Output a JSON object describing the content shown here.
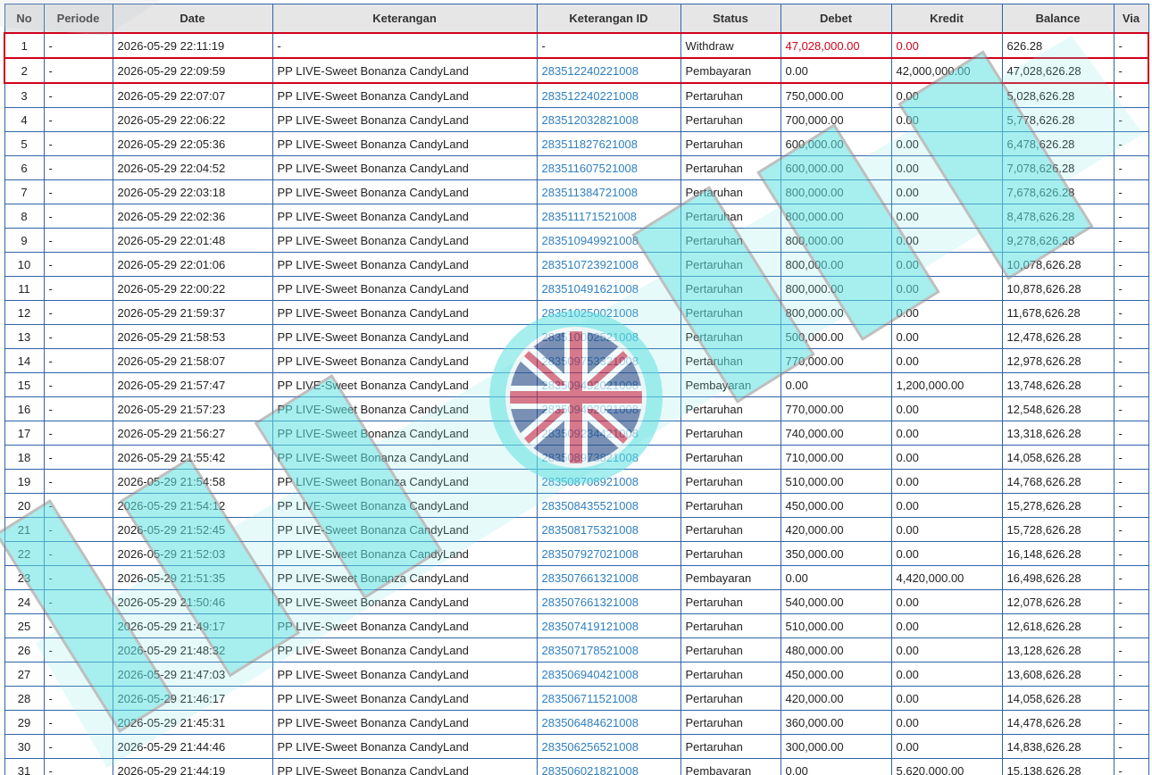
{
  "colors": {
    "accent_border": "#2f63a8",
    "highlight_border": "#d0021b",
    "link": "#2f7fc0",
    "header_bg": "#e6e6e6",
    "watermark": "#5fe0e0"
  },
  "watermark_icon": "union-jack-icon",
  "table": {
    "headers": [
      "No",
      "Periode",
      "Date",
      "Keterangan",
      "Keterangan ID",
      "Status",
      "Debet",
      "Kredit",
      "Balance",
      "Via"
    ],
    "rows": [
      {
        "no": "1",
        "periode": "-",
        "date": "2026-05-29 22:11:19",
        "keterangan": "-",
        "id": "-",
        "status": "Withdraw",
        "debet": "47,028,000.00",
        "kredit": "0.00",
        "balance": "626.28",
        "via": "-",
        "highlight": true,
        "red": true
      },
      {
        "no": "2",
        "periode": "-",
        "date": "2026-05-29 22:09:59",
        "keterangan": "PP LIVE-Sweet Bonanza CandyLand",
        "id": "283512240221008",
        "status": "Pembayaran",
        "debet": "0.00",
        "kredit": "42,000,000.00",
        "balance": "47,028,626.28",
        "via": "-",
        "highlight": true
      },
      {
        "no": "3",
        "periode": "-",
        "date": "2026-05-29 22:07:07",
        "keterangan": "PP LIVE-Sweet Bonanza CandyLand",
        "id": "283512240221008",
        "status": "Pertaruhan",
        "debet": "750,000.00",
        "kredit": "0.00",
        "balance": "5,028,626.28",
        "via": "-"
      },
      {
        "no": "4",
        "periode": "-",
        "date": "2026-05-29 22:06:22",
        "keterangan": "PP LIVE-Sweet Bonanza CandyLand",
        "id": "283512032821008",
        "status": "Pertaruhan",
        "debet": "700,000.00",
        "kredit": "0.00",
        "balance": "5,778,626.28",
        "via": "-"
      },
      {
        "no": "5",
        "periode": "-",
        "date": "2026-05-29 22:05:36",
        "keterangan": "PP LIVE-Sweet Bonanza CandyLand",
        "id": "283511827621008",
        "status": "Pertaruhan",
        "debet": "600,000.00",
        "kredit": "0.00",
        "balance": "6,478,626.28",
        "via": "-"
      },
      {
        "no": "6",
        "periode": "-",
        "date": "2026-05-29 22:04:52",
        "keterangan": "PP LIVE-Sweet Bonanza CandyLand",
        "id": "283511607521008",
        "status": "Pertaruhan",
        "debet": "600,000.00",
        "kredit": "0.00",
        "balance": "7,078,626.28",
        "via": "-"
      },
      {
        "no": "7",
        "periode": "-",
        "date": "2026-05-29 22:03:18",
        "keterangan": "PP LIVE-Sweet Bonanza CandyLand",
        "id": "283511384721008",
        "status": "Pertaruhan",
        "debet": "800,000.00",
        "kredit": "0.00",
        "balance": "7,678,626.28",
        "via": "-"
      },
      {
        "no": "8",
        "periode": "-",
        "date": "2026-05-29 22:02:36",
        "keterangan": "PP LIVE-Sweet Bonanza CandyLand",
        "id": "283511171521008",
        "status": "Pertaruhan",
        "debet": "800,000.00",
        "kredit": "0.00",
        "balance": "8,478,626.28",
        "via": "-"
      },
      {
        "no": "9",
        "periode": "-",
        "date": "2026-05-29 22:01:48",
        "keterangan": "PP LIVE-Sweet Bonanza CandyLand",
        "id": "283510949921008",
        "status": "Pertaruhan",
        "debet": "800,000.00",
        "kredit": "0.00",
        "balance": "9,278,626.28",
        "via": "-"
      },
      {
        "no": "10",
        "periode": "-",
        "date": "2026-05-29 22:01:06",
        "keterangan": "PP LIVE-Sweet Bonanza CandyLand",
        "id": "283510723921008",
        "status": "Pertaruhan",
        "debet": "800,000.00",
        "kredit": "0.00",
        "balance": "10,078,626.28",
        "via": "-"
      },
      {
        "no": "11",
        "periode": "-",
        "date": "2026-05-29 22:00:22",
        "keterangan": "PP LIVE-Sweet Bonanza CandyLand",
        "id": "283510491621008",
        "status": "Pertaruhan",
        "debet": "800,000.00",
        "kredit": "0.00",
        "balance": "10,878,626.28",
        "via": "-"
      },
      {
        "no": "12",
        "periode": "-",
        "date": "2026-05-29 21:59:37",
        "keterangan": "PP LIVE-Sweet Bonanza CandyLand",
        "id": "283510250021008",
        "status": "Pertaruhan",
        "debet": "800,000.00",
        "kredit": "0.00",
        "balance": "11,678,626.28",
        "via": "-"
      },
      {
        "no": "13",
        "periode": "-",
        "date": "2026-05-29 21:58:53",
        "keterangan": "PP LIVE-Sweet Bonanza CandyLand",
        "id": "283510002521008",
        "status": "Pertaruhan",
        "debet": "500,000.00",
        "kredit": "0.00",
        "balance": "12,478,626.28",
        "via": "-"
      },
      {
        "no": "14",
        "periode": "-",
        "date": "2026-05-29 21:58:07",
        "keterangan": "PP LIVE-Sweet Bonanza CandyLand",
        "id": "283509753321008",
        "status": "Pertaruhan",
        "debet": "770,000.00",
        "kredit": "0.00",
        "balance": "12,978,626.28",
        "via": "-"
      },
      {
        "no": "15",
        "periode": "-",
        "date": "2026-05-29 21:57:47",
        "keterangan": "PP LIVE-Sweet Bonanza CandyLand",
        "id": "283509492021008",
        "status": "Pembayaran",
        "debet": "0.00",
        "kredit": "1,200,000.00",
        "balance": "13,748,626.28",
        "via": "-"
      },
      {
        "no": "16",
        "periode": "-",
        "date": "2026-05-29 21:57:23",
        "keterangan": "PP LIVE-Sweet Bonanza CandyLand",
        "id": "283509492021008",
        "status": "Pertaruhan",
        "debet": "770,000.00",
        "kredit": "0.00",
        "balance": "12,548,626.28",
        "via": "-"
      },
      {
        "no": "17",
        "periode": "-",
        "date": "2026-05-29 21:56:27",
        "keterangan": "PP LIVE-Sweet Bonanza CandyLand",
        "id": "283509234421008",
        "status": "Pertaruhan",
        "debet": "740,000.00",
        "kredit": "0.00",
        "balance": "13,318,626.28",
        "via": "-"
      },
      {
        "no": "18",
        "periode": "-",
        "date": "2026-05-29 21:55:42",
        "keterangan": "PP LIVE-Sweet Bonanza CandyLand",
        "id": "283508973821008",
        "status": "Pertaruhan",
        "debet": "710,000.00",
        "kredit": "0.00",
        "balance": "14,058,626.28",
        "via": "-"
      },
      {
        "no": "19",
        "periode": "-",
        "date": "2026-05-29 21:54:58",
        "keterangan": "PP LIVE-Sweet Bonanza CandyLand",
        "id": "283508708921008",
        "status": "Pertaruhan",
        "debet": "510,000.00",
        "kredit": "0.00",
        "balance": "14,768,626.28",
        "via": "-"
      },
      {
        "no": "20",
        "periode": "-",
        "date": "2026-05-29 21:54:12",
        "keterangan": "PP LIVE-Sweet Bonanza CandyLand",
        "id": "283508435521008",
        "status": "Pertaruhan",
        "debet": "450,000.00",
        "kredit": "0.00",
        "balance": "15,278,626.28",
        "via": "-"
      },
      {
        "no": "21",
        "periode": "-",
        "date": "2026-05-29 21:52:45",
        "keterangan": "PP LIVE-Sweet Bonanza CandyLand",
        "id": "283508175321008",
        "status": "Pertaruhan",
        "debet": "420,000.00",
        "kredit": "0.00",
        "balance": "15,728,626.28",
        "via": "-"
      },
      {
        "no": "22",
        "periode": "-",
        "date": "2026-05-29 21:52:03",
        "keterangan": "PP LIVE-Sweet Bonanza CandyLand",
        "id": "283507927021008",
        "status": "Pertaruhan",
        "debet": "350,000.00",
        "kredit": "0.00",
        "balance": "16,148,626.28",
        "via": "-"
      },
      {
        "no": "23",
        "periode": "-",
        "date": "2026-05-29 21:51:35",
        "keterangan": "PP LIVE-Sweet Bonanza CandyLand",
        "id": "283507661321008",
        "status": "Pembayaran",
        "debet": "0.00",
        "kredit": "4,420,000.00",
        "balance": "16,498,626.28",
        "via": "-"
      },
      {
        "no": "24",
        "periode": "-",
        "date": "2026-05-29 21:50:46",
        "keterangan": "PP LIVE-Sweet Bonanza CandyLand",
        "id": "283507661321008",
        "status": "Pertaruhan",
        "debet": "540,000.00",
        "kredit": "0.00",
        "balance": "12,078,626.28",
        "via": "-"
      },
      {
        "no": "25",
        "periode": "-",
        "date": "2026-05-29 21:49:17",
        "keterangan": "PP LIVE-Sweet Bonanza CandyLand",
        "id": "283507419121008",
        "status": "Pertaruhan",
        "debet": "510,000.00",
        "kredit": "0.00",
        "balance": "12,618,626.28",
        "via": "-"
      },
      {
        "no": "26",
        "periode": "-",
        "date": "2026-05-29 21:48:32",
        "keterangan": "PP LIVE-Sweet Bonanza CandyLand",
        "id": "283507178521008",
        "status": "Pertaruhan",
        "debet": "480,000.00",
        "kredit": "0.00",
        "balance": "13,128,626.28",
        "via": "-"
      },
      {
        "no": "27",
        "periode": "-",
        "date": "2026-05-29 21:47:03",
        "keterangan": "PP LIVE-Sweet Bonanza CandyLand",
        "id": "283506940421008",
        "status": "Pertaruhan",
        "debet": "450,000.00",
        "kredit": "0.00",
        "balance": "13,608,626.28",
        "via": "-"
      },
      {
        "no": "28",
        "periode": "-",
        "date": "2026-05-29 21:46:17",
        "keterangan": "PP LIVE-Sweet Bonanza CandyLand",
        "id": "283506711521008",
        "status": "Pertaruhan",
        "debet": "420,000.00",
        "kredit": "0.00",
        "balance": "14,058,626.28",
        "via": "-"
      },
      {
        "no": "29",
        "periode": "-",
        "date": "2026-05-29 21:45:31",
        "keterangan": "PP LIVE-Sweet Bonanza CandyLand",
        "id": "283506484621008",
        "status": "Pertaruhan",
        "debet": "360,000.00",
        "kredit": "0.00",
        "balance": "14,478,626.28",
        "via": "-"
      },
      {
        "no": "30",
        "periode": "-",
        "date": "2026-05-29 21:44:46",
        "keterangan": "PP LIVE-Sweet Bonanza CandyLand",
        "id": "283506256521008",
        "status": "Pertaruhan",
        "debet": "300,000.00",
        "kredit": "0.00",
        "balance": "14,838,626.28",
        "via": "-"
      },
      {
        "no": "31",
        "periode": "-",
        "date": "2026-05-29 21:44:19",
        "keterangan": "PP LIVE-Sweet Bonanza CandyLand",
        "id": "283506021821008",
        "status": "Pembayaran",
        "debet": "0.00",
        "kredit": "5,620,000.00",
        "balance": "15,138,626.28",
        "via": "-"
      }
    ]
  }
}
